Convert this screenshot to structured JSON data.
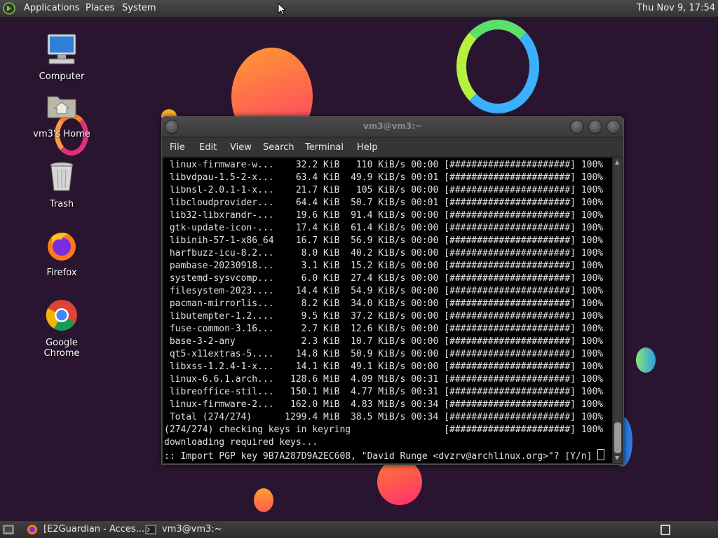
{
  "top_panel": {
    "menus": [
      "Applications",
      "Places",
      "System"
    ],
    "clock": "Thu Nov 9, 17:54"
  },
  "desktop_icons": [
    {
      "label": "Computer",
      "icon": "computer-icon"
    },
    {
      "label": "vm3's Home",
      "icon": "home-folder-icon"
    },
    {
      "label": "Trash",
      "icon": "trash-icon"
    },
    {
      "label": "Firefox",
      "icon": "firefox-icon"
    },
    {
      "label": "Google Chrome",
      "icon": "chrome-icon"
    }
  ],
  "terminal": {
    "title": "vm3@vm3:~",
    "menu": [
      "File",
      "Edit",
      "View",
      "Search",
      "Terminal",
      "Help"
    ],
    "lines": [
      " linux-firmware-w...    32.2 KiB   110 KiB/s 00:00 [######################] 100%",
      " libvdpau-1.5-2-x...    63.4 KiB  49.9 KiB/s 00:01 [######################] 100%",
      " libnsl-2.0.1-1-x...    21.7 KiB   105 KiB/s 00:00 [######################] 100%",
      " libcloudprovider...    64.4 KiB  50.7 KiB/s 00:01 [######################] 100%",
      " lib32-libxrandr-...    19.6 KiB  91.4 KiB/s 00:00 [######################] 100%",
      " gtk-update-icon-...    17.4 KiB  61.4 KiB/s 00:00 [######################] 100%",
      " libinih-57-1-x86_64    16.7 KiB  56.9 KiB/s 00:00 [######################] 100%",
      " harfbuzz-icu-8.2...     8.0 KiB  40.2 KiB/s 00:00 [######################] 100%",
      " pambase-20230918...     3.1 KiB  15.2 KiB/s 00:00 [######################] 100%",
      " systemd-sysvcomp...     6.0 KiB  27.4 KiB/s 00:00 [######################] 100%",
      " filesystem-2023....    14.4 KiB  54.9 KiB/s 00:00 [######################] 100%",
      " pacman-mirrorlis...     8.2 KiB  34.0 KiB/s 00:00 [######################] 100%",
      " libutempter-1.2....     9.5 KiB  37.2 KiB/s 00:00 [######################] 100%",
      " fuse-common-3.16...     2.7 KiB  12.6 KiB/s 00:00 [######################] 100%",
      " base-3-2-any            2.3 KiB  10.7 KiB/s 00:00 [######################] 100%",
      " qt5-x11extras-5....    14.8 KiB  50.9 KiB/s 00:00 [######################] 100%",
      " libxss-1.2.4-1-x...    14.1 KiB  49.1 KiB/s 00:00 [######################] 100%",
      " linux-6.6.1.arch...   128.6 MiB  4.09 MiB/s 00:31 [######################] 100%",
      " libreoffice-stil...   150.1 MiB  4.77 MiB/s 00:31 [######################] 100%",
      " linux-firmware-2...   162.0 MiB  4.83 MiB/s 00:34 [######################] 100%",
      " Total (274/274)      1299.4 MiB  38.5 MiB/s 00:34 [######################] 100%",
      "(274/274) checking keys in keyring                 [######################] 100%",
      "downloading required keys...",
      ":: Import PGP key 9B7A287D9A2EC608, \"David Runge <dvzrv@archlinux.org>\"? [Y/n] "
    ]
  },
  "bottom_panel": {
    "tasks": [
      "[E2Guardian - Acces...",
      "vm3@vm3:~"
    ]
  }
}
